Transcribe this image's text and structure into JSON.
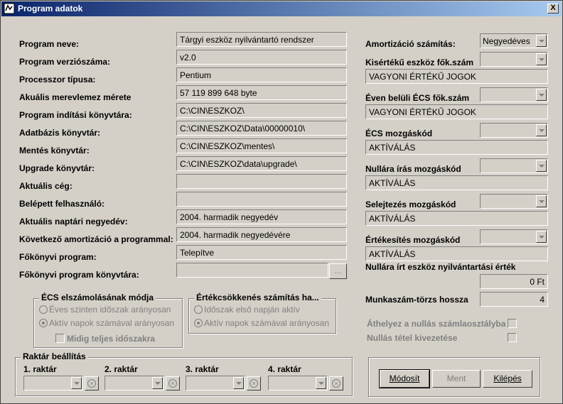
{
  "window": {
    "title": "Program adatok",
    "close_label": "X"
  },
  "left_rows": [
    {
      "label": "Program neve:",
      "value": "Tárgyi eszköz nyilvántartó rendszer"
    },
    {
      "label": "Program verziószáma:",
      "value": "v2.0"
    },
    {
      "label": "Processzor típusa:",
      "value": "Pentium"
    },
    {
      "label": "Akuális merevlemez mérete",
      "value": " 57 119 899 648 byte"
    },
    {
      "label": "Program indítási könyvtára:",
      "value": "C:\\CIN\\ESZKOZ\\"
    },
    {
      "label": "Adatbázis könyvtár:",
      "value": "C:\\CIN\\ESZKOZ\\Data\\00000010\\"
    },
    {
      "label": "Mentés könyvtár:",
      "value": "C:\\CIN\\ESZKOZ\\mentes\\"
    },
    {
      "label": "Upgrade könyvtár:",
      "value": "C:\\CIN\\ESZKOZ\\data\\upgrade\\"
    },
    {
      "label": "Aktuális cég:",
      "value": ""
    },
    {
      "label": "Belépett felhasználó:",
      "value": ""
    },
    {
      "label": "Aktuális naptári negyedév:",
      "value": "2004. harmadik negyedév"
    },
    {
      "label": "Következő amortizáció a programmal:",
      "value": "2004. harmadik negyedévére"
    },
    {
      "label": "Főkönyvi program:",
      "value": "Telepítve"
    },
    {
      "label": "Főkönyvi program könyvtára:",
      "value": ""
    }
  ],
  "browse_label": "...",
  "right": {
    "amort_label": "Amortizáció számítás:",
    "amort_value": "Negyedéves",
    "sections": [
      {
        "label": "Kisértékű eszköz fők.szám",
        "value": "VAGYONI ÉRTÉKŰ JOGOK"
      },
      {
        "label": "Éven belüli ÉCS fők.szám",
        "value": "VAGYONI ÉRTÉKŰ JOGOK"
      },
      {
        "label": "ÉCS mozgáskód",
        "value": "AKTÍVÁLÁS"
      },
      {
        "label": "Nullára írás mozgáskód",
        "value": "AKTÍVÁLÁS"
      },
      {
        "label": "Selejtezés mozgáskód",
        "value": "AKTÍVÁLÁS"
      },
      {
        "label": "Értékesítés mozgáskód",
        "value": "AKTÍVÁLÁS"
      }
    ],
    "nullara_label": "Nullára írt eszköz nyilvántartási érték",
    "nullara_value": "0 Ft",
    "munkaszam_label": "Munkaszám-törzs hossza",
    "munkaszam_value": "4",
    "athelyez_label": "Áthelyez a nullás számlaosztályba",
    "nullas_label": "Nullás tétel kivezetése"
  },
  "ecs_group": {
    "title": "ÉCS elszámolásának módja",
    "opt1": "Éves szinten időszak arányosan",
    "opt2": "Aktív napok számával arányosan",
    "check": "Midig teljes időszakra"
  },
  "ertek_group": {
    "title": "Értékcsökkenés számítás ha...",
    "opt1": "Időszak első napján aktív",
    "opt2": "Aktív napok számával arányosan"
  },
  "raktar": {
    "title": "Raktár beállítás",
    "items": [
      "1. raktár",
      "2. raktár",
      "3. raktár",
      "4. raktár"
    ]
  },
  "buttons": {
    "modosit": "Módosít",
    "ment": "Ment",
    "kilepes": "Kilépés"
  }
}
